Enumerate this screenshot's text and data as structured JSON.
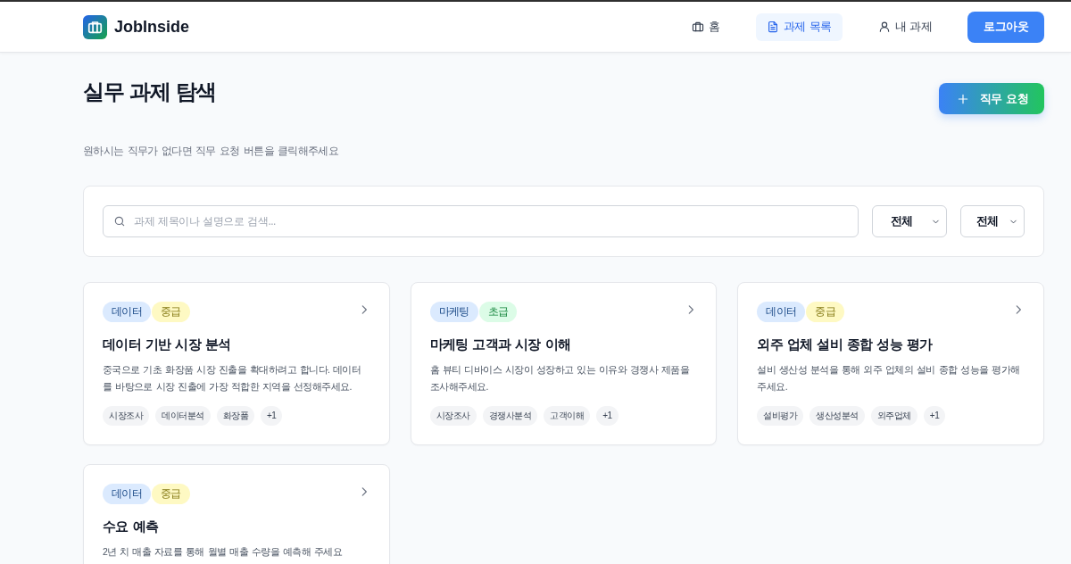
{
  "header": {
    "logo": {
      "text": "JobInside"
    },
    "nav": [
      {
        "label": "홈",
        "selected": false
      },
      {
        "label": "과제 목록",
        "selected": true
      },
      {
        "label": "내 과제",
        "selected": false
      }
    ],
    "logout_button": "로그아웃"
  },
  "page": {
    "title": "실무 과제 탐색",
    "request_button": "직무 요청",
    "subtitle": "원하시는 직무가 없다면 직무 요청 버튼을 클릭해주세요"
  },
  "filters": {
    "search": {
      "placeholder": "과제 제목이나 설명으로 검색..."
    },
    "dropdowns": [
      {
        "value": "전체"
      },
      {
        "value": "전체"
      }
    ]
  },
  "cards": [
    {
      "badges": [
        {
          "label": "데이터",
          "color": "#dbeafe"
        },
        {
          "label": "중급",
          "color": "#fef9c3"
        }
      ],
      "title": "데이터 기반 시장 분석",
      "description": "중국으로 기초 화장품 시장 진출을 확대하려고 합니다. 데이터를 바탕으로 시장 진출에 가장 적합한 지역을 선정해주세요.",
      "tags": [
        "시장조사",
        "데이터분석",
        "화장품",
        "+1"
      ]
    },
    {
      "badges": [
        {
          "label": "마케팅",
          "color": "#dbeafe"
        },
        {
          "label": "초급",
          "color": "#dcfce7"
        }
      ],
      "title": "마케팅 고객과 시장 이해",
      "description": "홈 뷰티 디바이스 시장이 성장하고 있는 이유와 경쟁사 제품을 조사해주세요.",
      "tags": [
        "시장조사",
        "경쟁사분석",
        "고객이해",
        "+1"
      ]
    },
    {
      "badges": [
        {
          "label": "데이터",
          "color": "#dbeafe"
        },
        {
          "label": "중급",
          "color": "#fef9c3"
        }
      ],
      "title": "외주 업체 설비 종합 성능 평가",
      "description": "설비 생산성 분석을 통해 외주 업체의 설비 종합 성능을 평가해 주세요.",
      "tags": [
        "설비평가",
        "생산성분석",
        "외주업체",
        "+1"
      ]
    },
    {
      "badges": [
        {
          "label": "데이터",
          "color": "#dbeafe"
        },
        {
          "label": "중급",
          "color": "#fef9c3"
        }
      ],
      "title": "수요 예측",
      "description": "2년 치 매출 자료를 통해 월별 매출 수량을 예측해 주세요"
    }
  ]
}
